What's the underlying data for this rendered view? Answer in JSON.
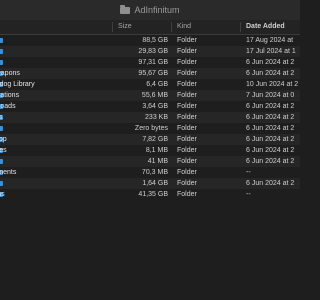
{
  "window": {
    "title": "AdInfinitum"
  },
  "columns": {
    "size": "Size",
    "kind": "Kind",
    "date": "Date Added"
  },
  "rows": [
    {
      "name": "y",
      "size": "88,5 GB",
      "kind": "Folder",
      "date": "17 Aug 2024 at"
    },
    {
      "name": "n",
      "size": "29,83 GB",
      "kind": "Folder",
      "date": "17 Jul 2024 at 1"
    },
    {
      "name": "",
      "size": "97,31 GB",
      "kind": "Folder",
      "date": "6 Jun 2024 at 2"
    },
    {
      "name": "ofweapons",
      "size": "95,67 GB",
      "kind": "Folder",
      "date": "6 Jun 2024 at 2"
    },
    {
      "name": "eamdog Library",
      "size": "6,4 GB",
      "kind": "Folder",
      "date": "10 Jun 2024 at 2"
    },
    {
      "name": "pplications",
      "size": "55,6 MB",
      "kind": "Folder",
      "date": "7 Jun 2024 at 0"
    },
    {
      "name": "ownloads",
      "size": "3,64 GB",
      "kind": "Folder",
      "date": "6 Jun 2024 at 2"
    },
    {
      "name": "ovies",
      "size": "233 KB",
      "kind": "Folder",
      "date": "6 Jun 2024 at 2"
    },
    {
      "name": "ublic",
      "size": "Zero bytes",
      "kind": "Folder",
      "date": "6 Jun 2024 at 2"
    },
    {
      "name": "esktop",
      "size": "7,82 GB",
      "kind": "Folder",
      "date": "6 Jun 2024 at 2"
    },
    {
      "name": "ictures",
      "size": "8,1 MB",
      "kind": "Folder",
      "date": "6 Jun 2024 at 2"
    },
    {
      "name": "usic",
      "size": "41 MB",
      "kind": "Folder",
      "date": "6 Jun 2024 at 2"
    },
    {
      "name": "ocuments",
      "size": "70,3 MB",
      "kind": "Folder",
      "date": "--"
    },
    {
      "name": "red",
      "size": "1,64 GB",
      "kind": "Folder",
      "date": "6 Jun 2024 at 2"
    },
    {
      "name": "ations",
      "size": "41,35 GB",
      "kind": "Folder",
      "date": "--"
    }
  ]
}
